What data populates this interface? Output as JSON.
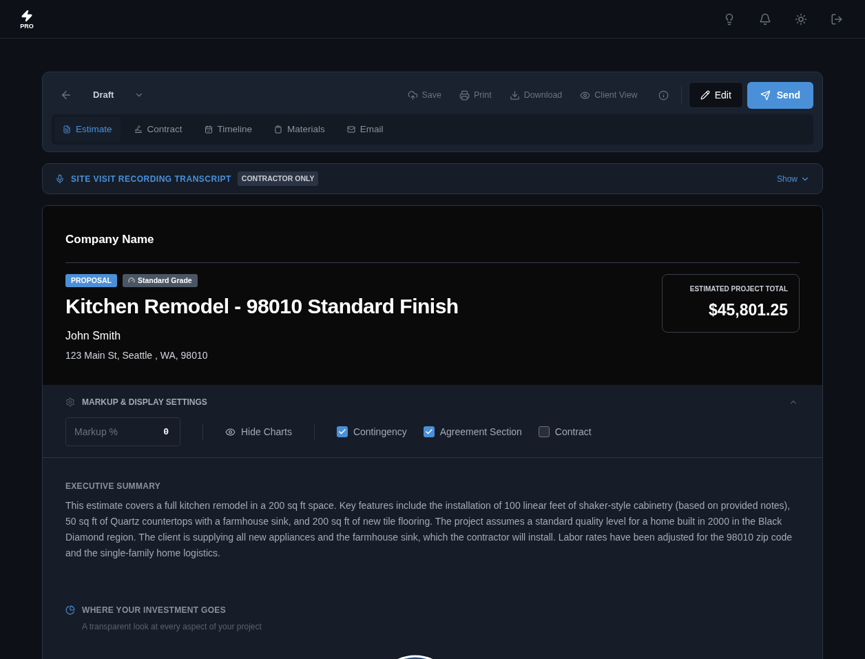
{
  "logo": {
    "text": "PRO"
  },
  "toolbar": {
    "status": "Draft",
    "actions": [
      {
        "kind": "save",
        "label": "Save"
      },
      {
        "kind": "print",
        "label": "Print"
      },
      {
        "kind": "download",
        "label": "Download"
      },
      {
        "kind": "view",
        "label": "Client View"
      }
    ],
    "edit": "Edit",
    "send": "Send"
  },
  "tabs": [
    {
      "kind": "estimate",
      "label": "Estimate",
      "selected": true
    },
    {
      "kind": "contract",
      "label": "Contract",
      "selected": false
    },
    {
      "kind": "timeline",
      "label": "Timeline",
      "selected": false
    },
    {
      "kind": "materials",
      "label": "Materials",
      "selected": false
    },
    {
      "kind": "email",
      "label": "Email",
      "selected": false
    }
  ],
  "transcript": {
    "title": "SITE VISIT RECORDING TRANSCRIPT",
    "badge": "CONTRACTOR ONLY",
    "toggle": "Show"
  },
  "proposal": {
    "company": "Company Name",
    "badges": [
      "PROPOSAL",
      "Standard Grade"
    ],
    "title": "Kitchen Remodel - 98010 Standard Finish",
    "client": "John Smith",
    "address": "123 Main St, Seattle , WA, 98010",
    "total_label": "ESTIMATED PROJECT TOTAL",
    "total": "$45,801.25"
  },
  "settings": {
    "title": "MARKUP & DISPLAY SETTINGS",
    "expanded": true,
    "markup_placeholder": "Markup %",
    "markup_value": "0",
    "hide_charts": "Hide Charts",
    "checks": [
      {
        "label": "Contingency",
        "checked": true
      },
      {
        "label": "Agreement Section",
        "checked": true
      },
      {
        "label": "Contract",
        "checked": false
      }
    ]
  },
  "summary": {
    "heading": "EXECUTIVE SUMMARY",
    "text": "This estimate covers a full kitchen remodel in a 200 sq ft space. Key features include the installation of 100 linear feet of shaker-style cabinetry (based on provided notes), 50 sq ft of Quartz countertops with a farmhouse sink, and 200 sq ft of new tile flooring. The project assumes a standard quality level for a home built in 2000 in the Black Diamond region. The client is supplying all new appliances and the farmhouse sink, which the contractor will install. Labor rates have been adjusted for the 98010 zip code and the single-family home logistics."
  },
  "investment": {
    "heading": "WHERE YOUR INVESTMENT GOES",
    "subtitle": "A transparent look at every aspect of your project"
  }
}
